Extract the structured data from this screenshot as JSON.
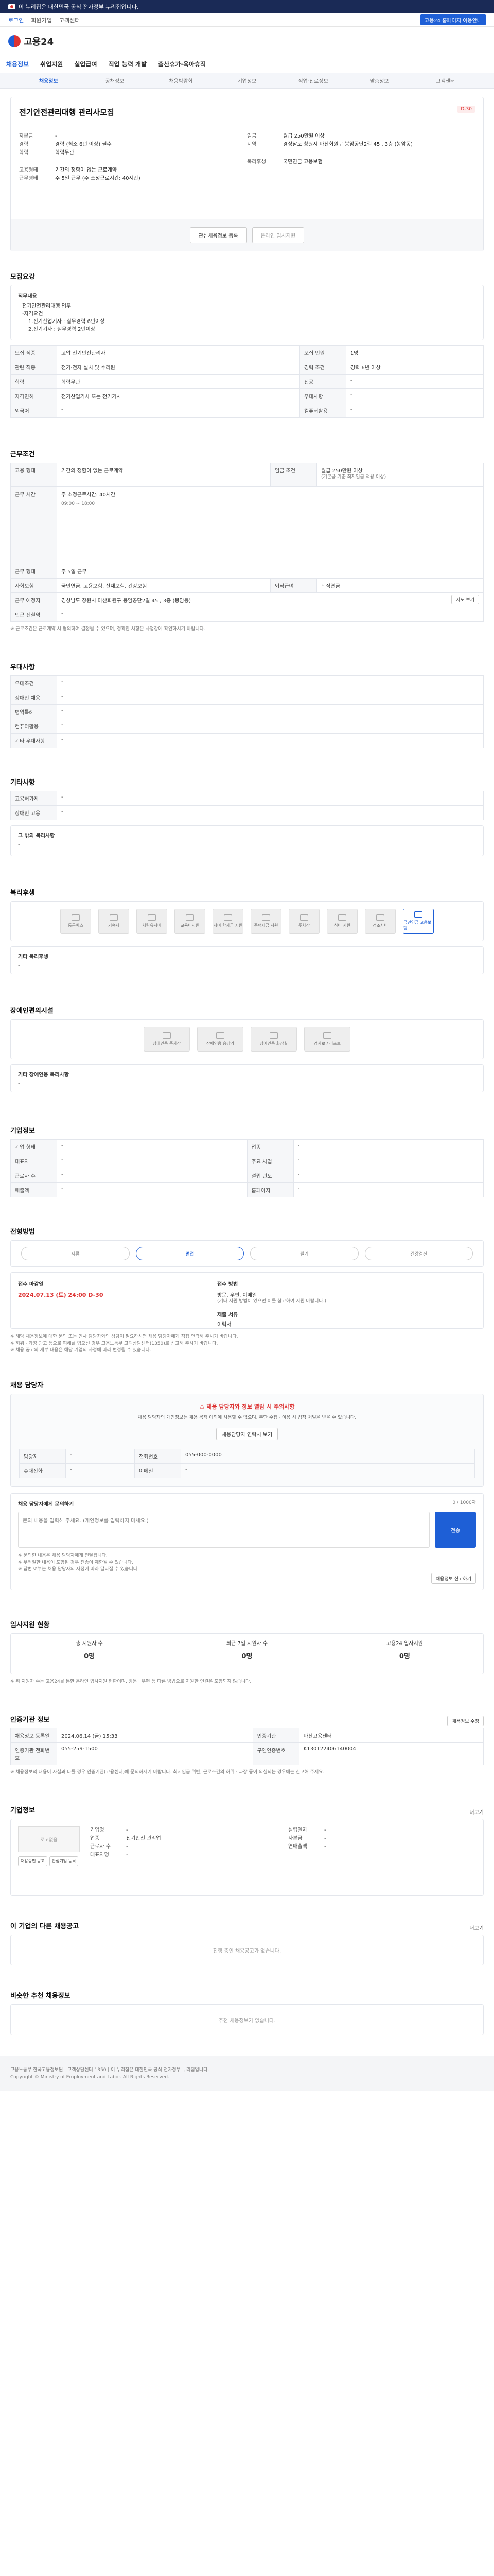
{
  "topbar": {
    "official_text": "이 누리집은 대한민국 공식 전자정부 누리집입니다."
  },
  "util": {
    "links": [
      "로그인",
      "회원가입",
      "고객센터"
    ],
    "right_button": "고용24 홈페이지 이용안내"
  },
  "header": {
    "logo_text": "고용24"
  },
  "gnb": [
    "채용정보",
    "취업지원",
    "실업급여",
    "직업 능력 개발",
    "출산휴가·육아휴직"
  ],
  "subnav": [
    "채용정보",
    "공채정보",
    "채용박람회",
    "기업정보",
    "직업·진로정보",
    "맞춤정보",
    "고객센터"
  ],
  "job": {
    "company": "",
    "title": "전기안전관리대행 관리사모집",
    "badge": "D-30",
    "left": [
      {
        "k": "자본금",
        "v": "-"
      },
      {
        "k": "경력",
        "v": "경력 (최소 6년 이상) 필수"
      },
      {
        "k": "학력",
        "v": "학력무관"
      }
    ],
    "right": [
      {
        "k": "임금",
        "v": "월급 250만원 이상"
      },
      {
        "k": "지역",
        "v": "경상남도 창원시 마산회원구 봉암공단2길 45 , 3층 (봉암동)"
      }
    ],
    "left2": [
      {
        "k": "고용형태",
        "v": "기간의 정함이 없는 근로계약"
      },
      {
        "k": "근무형태",
        "v": "주 5일 근무 (주 소정근로시간: 40시간)"
      }
    ],
    "right2": [
      {
        "k": "복리후생",
        "v": "국민연금 고용보험"
      }
    ],
    "btn_apply": "온라인 입사지원",
    "btn_scrap": "관심채용정보 등록"
  },
  "recruit": {
    "section": "모집요강",
    "duty_label": "직무내용",
    "duty": [
      "전기안전관리대행 업무",
      "-자격요건",
      "1.전기산업기사 : 실무경력 6년이상",
      "2.전기기사 : 실무경력 2년이상"
    ],
    "rows": [
      {
        "k": "모집 직종",
        "v": "고압 전기안전관리자",
        "k2": "모집 인원",
        "v2": "1명"
      },
      {
        "k": "관련 직종",
        "v": "전기·전자 설치 및 수리원",
        "k2": "경력 조건",
        "v2": "경력 6년 이상"
      },
      {
        "k": "학력",
        "v": "학력무관",
        "k2": "전공",
        "v2": "-"
      },
      {
        "k": "자격면허",
        "v": "전기산업기사 또는 전기기사",
        "k2": "우대사항",
        "v2": "-"
      },
      {
        "k": "외국어",
        "v": "-",
        "k2": "컴퓨터활용",
        "v2": "-"
      }
    ]
  },
  "work": {
    "section": "근무조건",
    "employment_label": "고용 형태",
    "employment": "기간의 정함이 없는 근로계약",
    "wage_label": "임금 조건",
    "wage": "월급 250만원 이상",
    "wage_note": "(기본급 기준 최저임금 적용 이상)",
    "hours_label": "근무 시간",
    "hours": "주 소정근로시간: 40시간",
    "hours_detail": "09:00 ~ 18:00",
    "days_label": "근무 형태",
    "days": "주 5일 근무",
    "insurance_label": "사회보험",
    "insurance": "국민연금, 고용보험, 산재보험, 건강보험",
    "retire_label": "퇴직급여",
    "retire": "퇴직연금",
    "location_label": "근무 예정지",
    "location": "경상남도 창원시 마산회원구 봉암공단2길 45 , 3층 (봉암동)",
    "map_button": "지도 보기",
    "near_label": "인근 전철역",
    "near": "-",
    "note": "※ 근로조건은 근로계약 시 협의하여 결정될 수 있으며, 정확한 사항은 사업장에 확인하시기 바랍니다."
  },
  "prefer": {
    "section": "우대사항",
    "rows": [
      {
        "k": "우대조건",
        "v": "-"
      },
      {
        "k": "장애인 채용",
        "v": "-"
      },
      {
        "k": "병역특례",
        "v": "-"
      },
      {
        "k": "컴퓨터활용",
        "v": "-"
      },
      {
        "k": "기타 우대사항",
        "v": "-"
      }
    ]
  },
  "etc": {
    "section": "기타사항",
    "rows": [
      {
        "k": "고용허가제",
        "v": "-"
      },
      {
        "k": "장애인 고용",
        "v": "-"
      }
    ],
    "extra_label": "그 밖의 복리사항",
    "extra": "-"
  },
  "welfare": {
    "section": "복리후생",
    "tiles": [
      "통근버스",
      "기숙사",
      "차량유지비",
      "교육비지원",
      "자녀 학자금 지원",
      "주택자금 지원",
      "주차장",
      "식비 지원",
      "경조사비",
      "국민연금 고용보험"
    ],
    "on_index": 9,
    "other_label": "기타 복리후생",
    "other": "-"
  },
  "disabled": {
    "section": "장애인편의시설",
    "tiles": [
      "장애인용 주차장",
      "장애인용 승강기",
      "장애인용 화장실",
      "경사로 / 리프트"
    ],
    "note_label": "기타 장애인용 복리사항",
    "note": "-"
  },
  "company_info": {
    "section": "기업정보",
    "rows": [
      {
        "k": "기업 형태",
        "v": "-",
        "k2": "업종",
        "v2": "-"
      },
      {
        "k": "대표자",
        "v": "-",
        "k2": "주요 사업",
        "v2": "-"
      },
      {
        "k": "근로자 수",
        "v": "-",
        "k2": "설립 년도",
        "v2": "-"
      },
      {
        "k": "매출액",
        "v": "-",
        "k2": "홈페이지",
        "v2": "-"
      }
    ]
  },
  "process": {
    "section": "전형방법",
    "steps": [
      "서류",
      "면접",
      "필기",
      "건강검진"
    ],
    "on_index": 1,
    "deadline_label": "접수 마감일",
    "deadline": "2024.07.13 (토) 24:00",
    "dday": "D-30",
    "method_label": "접수 방법",
    "method": "방문, 우편, 이메일",
    "method_detail": "(기타 지원 방법이 있으면 이를 참고하여 지원 바랍니다.)",
    "docs_label": "제출 서류",
    "docs": "이력서",
    "notes": [
      "※ 해당 채용정보에 대한 문의 또는 인사 담당자와의 상담이 필요하시면 채용 담당자에게 직접 연락해 주시기 바랍니다.",
      "※ 허위 · 과장 광고 등으로 피해를 입으신 경우 고용노동부 고객상담센터(1350)로 신고해 주시기 바랍니다.",
      "※ 채용 공고의 세부 내용은 해당 기업의 사정에 따라 변경될 수 있습니다."
    ]
  },
  "contact": {
    "section": "채용 담당자",
    "banner_title": "채용 담당자와 정보 열람 시 주의사항",
    "banner_text": "채용 담당자의 개인정보는 채용 목적 이외에 사용할 수 없으며, 무단 수집 · 이용 시 법적 처벌을 받을 수 있습니다.",
    "banner_btn": "채용담당자 연락처 보기",
    "rows": [
      {
        "k": "담당자",
        "v": "-"
      },
      {
        "k": "전화번호",
        "v": "055-000-0000"
      },
      {
        "k": "휴대전화",
        "v": "-"
      },
      {
        "k": "이메일",
        "v": "-"
      }
    ],
    "report_title": "채용 담당자에게 문의하기",
    "report_placeholder": "문의 내용을 입력해 주세요. (개인정보를 입력하지 마세요.)",
    "counter": "0 / 1000자",
    "submit": "전송",
    "notes": [
      "※ 문의한 내용은 채용 담당자에게 전달됩니다.",
      "※ 부적절한 내용이 포함된 경우 전송이 제한될 수 있습니다.",
      "※ 답변 여부는 채용 담당자의 사정에 따라 달라질 수 있습니다."
    ],
    "more_btn": "채용정보 신고하기"
  },
  "apply_status": {
    "section": "입사지원 현황",
    "cards": [
      {
        "label": "총 지원자 수",
        "value": "0명"
      },
      {
        "label": "최근 7일 지원자 수",
        "value": "0명"
      },
      {
        "label": "고용24 입사지원",
        "value": "0명"
      }
    ],
    "note": "※ 위 지원자 수는 고용24를 통한 온라인 입사지원 현황이며, 방문 · 우편 등 다른 방법으로 지원한 인원은 포함되지 않습니다."
  },
  "agency": {
    "section": "인증기관 정보",
    "btn": "채용정보 수정",
    "rows": [
      {
        "k": "채용정보 등록일",
        "v": "2024.06.14 (금) 15:33",
        "k2": "인증기관",
        "v2": "마산고용센터"
      },
      {
        "k": "인증기관 전화번호",
        "v": "055-259-1500",
        "k2": "구인인증번호",
        "v2": "K130122406140004"
      }
    ],
    "note": "※ 채용정보의 내용이 사실과 다를 경우 인증기관(고용센터)에 문의하시기 바랍니다. 최저임금 위반, 근로조건의 허위 · 과장 등이 의심되는 경우에는 신고해 주세요."
  },
  "corp": {
    "section": "기업정보",
    "more": "더보기",
    "logo_text": "로고없음",
    "left": [
      {
        "k": "기업명",
        "v": "-"
      },
      {
        "k": "업종",
        "v": "전기안전 관리업"
      },
      {
        "k": "근로자 수",
        "v": "-"
      },
      {
        "k": "대표자명",
        "v": "-"
      }
    ],
    "right": [
      {
        "k": "설립일자",
        "v": "-"
      },
      {
        "k": "자본금",
        "v": "-"
      },
      {
        "k": "연매출액",
        "v": "-"
      }
    ],
    "btn_list": "채용중인 공고",
    "btn_follow": "관심기업 등록"
  },
  "same_company": {
    "section": "이 기업의 다른 채용공고",
    "more": "더보기",
    "empty": "진행 중인 채용공고가 없습니다."
  },
  "similar": {
    "section": "비슷한 추천 채용정보",
    "empty": "추천 채용정보가 없습니다."
  },
  "footer": {
    "text": "고용노동부 한국고용정보원 | 고객상담센터 1350 | 이 누리집은 대한민국 공식 전자정부 누리집입니다.",
    "copy": "Copyright © Ministry of Employment and Labor. All Rights Reserved."
  }
}
